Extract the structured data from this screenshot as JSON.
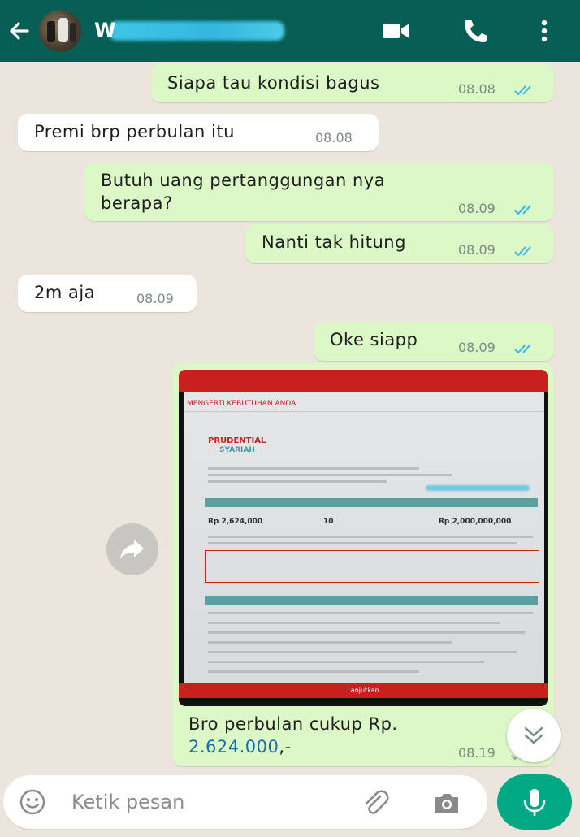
{
  "header": {
    "contact_name": "W",
    "contact_name_tail": "p"
  },
  "messages": [
    {
      "dir": "out",
      "text": "Siapa tau kondisi bagus",
      "time": "08.08",
      "read": true
    },
    {
      "dir": "in",
      "text": "Premi brp perbulan itu",
      "time": "08.08"
    },
    {
      "dir": "out",
      "text_line1": "Butuh uang pertanggungan nya",
      "text_line2": "berapa?",
      "time": "08.09",
      "read": true
    },
    {
      "dir": "out",
      "text": "Nanti tak hitung",
      "time": "08.09",
      "read": true
    },
    {
      "dir": "in",
      "text": "2m aja",
      "time": "08.09"
    },
    {
      "dir": "out",
      "text": "Oke siapp",
      "time": "08.09",
      "read": true
    }
  ],
  "image_message": {
    "screenshot": {
      "section_title": "MENGERTI KEBUTUHAN ANDA",
      "logo": "PRUDENTIAL",
      "logo_sub": "SYARIAH",
      "app_name": "PRUfuture",
      "contribution_label": "Total Kontribusi (Bulanan)",
      "contribution_value": "Rp 2,624,000",
      "period_label": "Masa Pembayaran Kontribusi (Tahun)",
      "period_value": "10",
      "sum_label": "Santunan Asuransi",
      "sum_value": "Rp 2,000,000,000",
      "footer_button": "Lanjutkan"
    },
    "caption_text": "Bro perbulan cukup Rp.",
    "caption_number": "2.624.000",
    "caption_suffix": ",-",
    "time": "08.19",
    "read": false
  },
  "input": {
    "placeholder": "Ketik pesan"
  },
  "colors": {
    "header": "#075e54",
    "outgoing": "#dcf8c6",
    "incoming": "#ffffff",
    "read_ticks": "#34b7f1",
    "mic": "#00a884"
  },
  "icons": [
    "back-arrow-icon",
    "video-call-icon",
    "phone-icon",
    "more-vert-icon",
    "forward-icon",
    "chevron-double-down-icon",
    "emoji-icon",
    "attach-icon",
    "camera-icon",
    "mic-icon"
  ]
}
